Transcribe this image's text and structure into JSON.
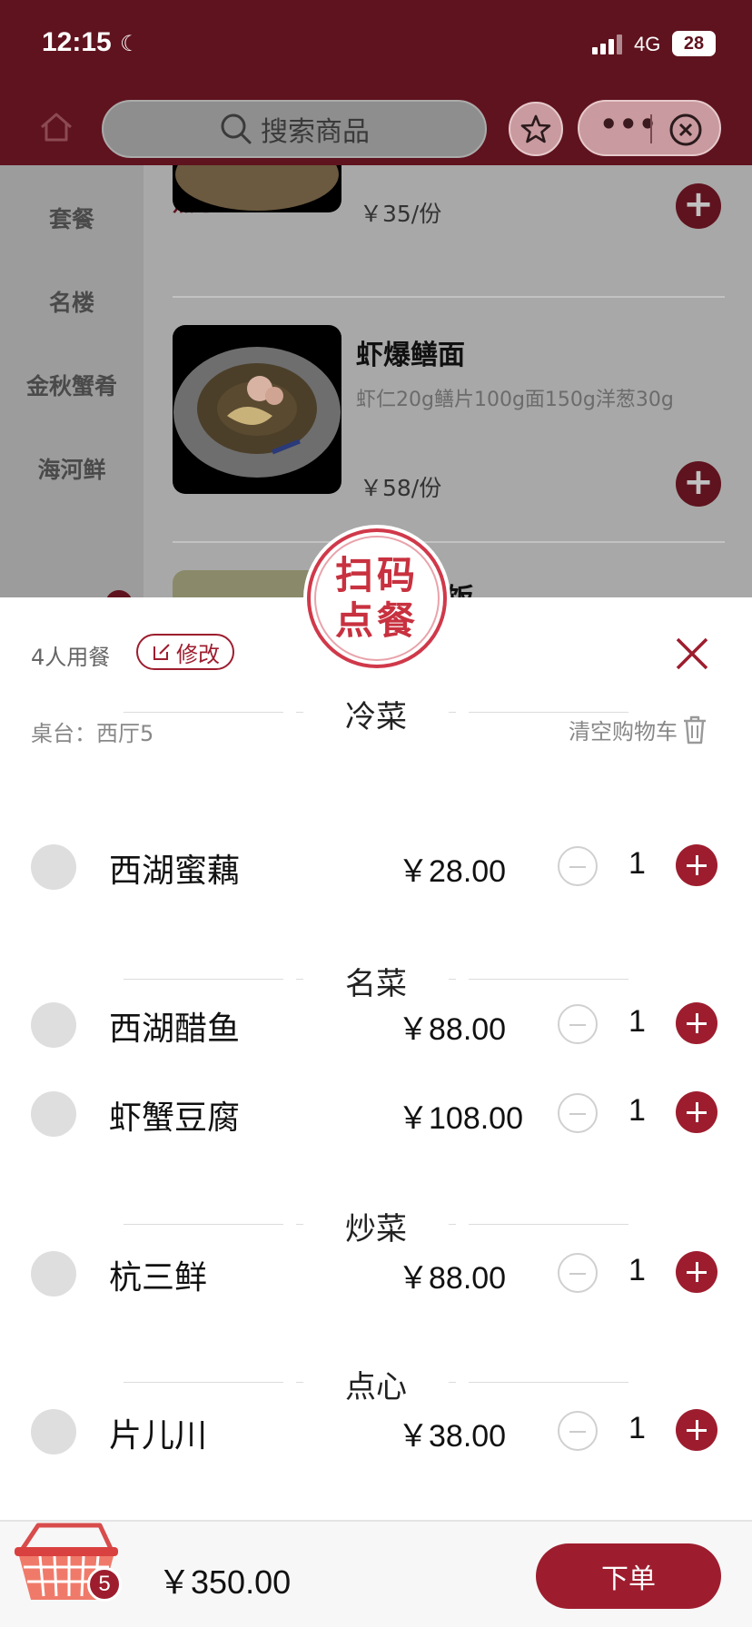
{
  "status": {
    "time": "12:15",
    "network": "4G",
    "battery": "28"
  },
  "nav": {
    "search_placeholder": "搜索商品"
  },
  "menu": {
    "categories": [
      "套餐",
      "名楼",
      "金秋蟹肴",
      "海河鲜"
    ],
    "section_title": "点心",
    "items": [
      {
        "price": "￥35/份"
      },
      {
        "name": "虾爆鳝面",
        "desc": "虾仁20g鳝片100g面150g洋葱30g",
        "price": "￥58/份"
      },
      {
        "name_partial": "饭"
      }
    ]
  },
  "stamp": {
    "line1": "扫码",
    "line2": "点餐"
  },
  "sheet": {
    "guests": "4人用餐",
    "edit_label": "修改",
    "table": "桌台：西厅5",
    "clear_label": "清空购物车",
    "sections": [
      {
        "title": "冷菜",
        "items": [
          {
            "name": "西湖蜜藕",
            "price": "￥28.00",
            "qty": "1"
          }
        ]
      },
      {
        "title": "名菜",
        "items": [
          {
            "name": "西湖醋鱼",
            "price": "￥88.00",
            "qty": "1"
          },
          {
            "name": "虾蟹豆腐",
            "price": "￥108.00",
            "qty": "1"
          }
        ]
      },
      {
        "title": "炒菜",
        "items": [
          {
            "name": "杭三鲜",
            "price": "￥88.00",
            "qty": "1"
          }
        ]
      },
      {
        "title": "点心",
        "items": [
          {
            "name": "片儿川",
            "price": "￥38.00",
            "qty": "1"
          }
        ]
      }
    ]
  },
  "footer": {
    "cart_count": "5",
    "total": "￥350.00",
    "order_label": "下单"
  },
  "colors": {
    "brand": "#9d1d2e",
    "header": "#5f131e",
    "stamp": "#c8313f"
  }
}
